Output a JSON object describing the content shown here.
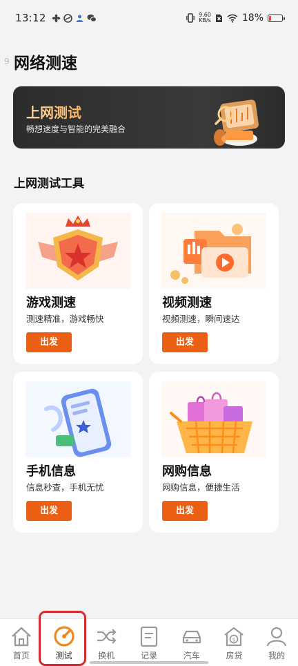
{
  "status": {
    "time": "13:12",
    "net_speed_value": "9.60",
    "net_speed_unit": "KB/s",
    "battery": "18%",
    "battery_level": 0.18
  },
  "header": {
    "ghost_char": "9",
    "title": "网络测速"
  },
  "banner": {
    "title": "上网测试",
    "subtitle": "畅想速度与智能的完美融合"
  },
  "section": {
    "title": "上网测试工具"
  },
  "cards": [
    {
      "title": "游戏测速",
      "desc": "测速精准，游戏畅快",
      "button": "出发"
    },
    {
      "title": "视频测速",
      "desc": "视频测速，瞬间速达",
      "button": "出发"
    },
    {
      "title": "手机信息",
      "desc": "信息秒查，手机无忧",
      "button": "出发"
    },
    {
      "title": "网购信息",
      "desc": "网购信息，便捷生活",
      "button": "出发"
    }
  ],
  "tabbar": {
    "items": [
      {
        "label": "首页",
        "icon": "home-icon"
      },
      {
        "label": "测试",
        "icon": "speedometer-icon",
        "active": true
      },
      {
        "label": "换机",
        "icon": "shuffle-icon"
      },
      {
        "label": "记录",
        "icon": "document-icon"
      },
      {
        "label": "汽车",
        "icon": "car-icon"
      },
      {
        "label": "房贷",
        "icon": "house-money-icon"
      },
      {
        "label": "我的",
        "icon": "user-icon"
      }
    ]
  },
  "colors": {
    "accent": "#ea5f14",
    "highlight": "#d52b2b",
    "banner_bg": "#2c2c2c"
  }
}
